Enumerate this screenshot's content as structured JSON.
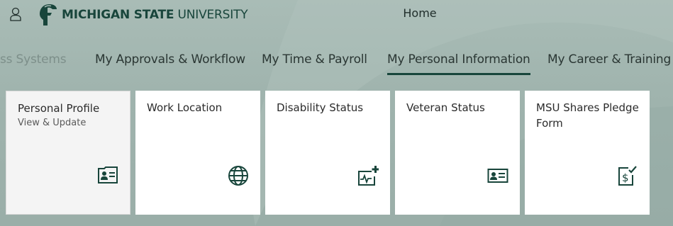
{
  "header": {
    "logo_bold": "MICHIGAN STATE",
    "logo_thin": " UNIVERSITY",
    "title": "Home"
  },
  "tabs": [
    {
      "label": "ss Systems",
      "state": "partially-visible"
    },
    {
      "label": "My Approvals & Workflow"
    },
    {
      "label": "My Time & Payroll"
    },
    {
      "label": "My Personal Information",
      "selected": true
    },
    {
      "label": "My Career & Training"
    }
  ],
  "tiles": [
    {
      "title": "Personal Profile",
      "subtitle": "View & Update",
      "icon": "contact-card-icon"
    },
    {
      "title": "Work Location",
      "icon": "globe-icon"
    },
    {
      "title": "Disability Status",
      "icon": "medical-monitor-icon"
    },
    {
      "title": "Veteran Status",
      "icon": "id-card-icon"
    },
    {
      "title": "MSU Shares Pledge Form",
      "icon": "dollar-document-check-icon"
    }
  ],
  "colors": {
    "brand": "#18453b",
    "background": "#a9bcb6",
    "tile": "#ffffff"
  }
}
